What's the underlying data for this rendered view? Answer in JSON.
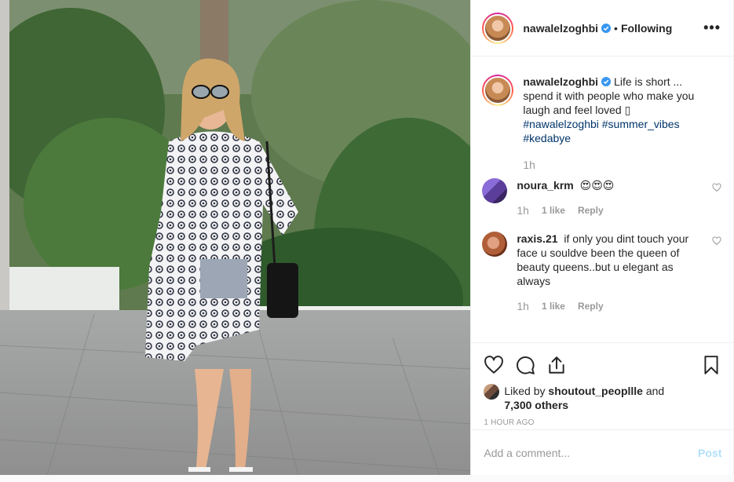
{
  "post": {
    "author": "nawalelzoghbi",
    "follow_status": "Following",
    "separator": "•",
    "more_label": "•••",
    "photo_alt": "Woman in sunglasses and patterned kaftan standing in front of tropical plants"
  },
  "caption": {
    "username": "nawalelzoghbi",
    "text": "Life is short ... spend it with people who make you laugh and feel loved",
    "hashtags": "#nawalelzoghbi #summer_vibes #kedabye",
    "time": "1h"
  },
  "comments": [
    {
      "username": "noura_krm",
      "text": "😍😍😍",
      "time": "1h",
      "likes": "1 like",
      "reply": "Reply"
    },
    {
      "username": "raxis.21",
      "text": "if only you dint touch your face u souldve been the queen of beauty queens..but u elegant as always",
      "time": "1h",
      "likes": "1 like",
      "reply": "Reply"
    }
  ],
  "likes": {
    "prefix": "Liked by",
    "user": "shoutout_peopllle",
    "conjunction": "and",
    "others": "7,300 others"
  },
  "timestamp": "1 HOUR AGO",
  "add_comment": {
    "placeholder": "Add a comment...",
    "post_label": "Post"
  },
  "colors": {
    "hashtag": "#003569",
    "post_disabled": "#b2dffc",
    "verified": "#3897f0",
    "muted": "#999999"
  },
  "icons": [
    "heart-icon",
    "comment-icon",
    "share-icon",
    "bookmark-icon",
    "verified-icon",
    "more-icon"
  ]
}
